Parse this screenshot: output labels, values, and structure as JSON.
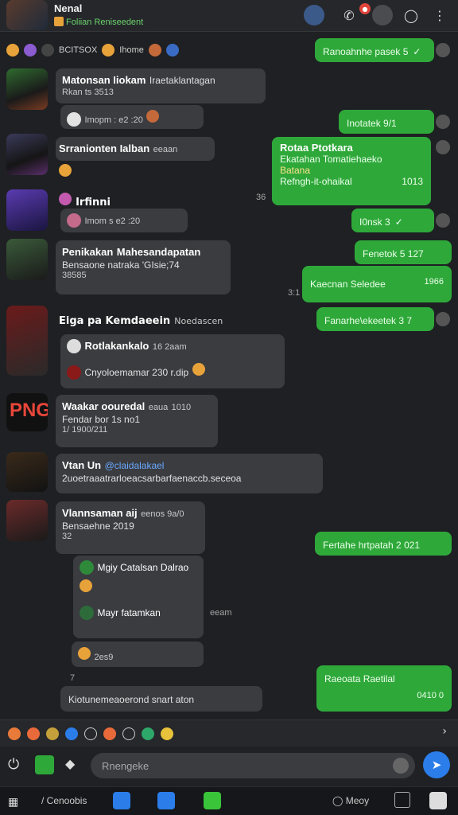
{
  "header": {
    "title": "Nenal",
    "subtitle": "Foliian Reniseedent"
  },
  "pinned": {
    "text1": "BCITSOX",
    "text2": "Ihome"
  },
  "messages": {
    "m1": {
      "name": "Matonsan Iiokam",
      "name_suffix": "Iraetaklantagan",
      "line": "Rkan ts 3513",
      "sub": "Imopm : e2 :20"
    },
    "m2": {
      "name": "Srranionten Ialban",
      "name_suffix": "eeaan"
    },
    "m3": {
      "name": "Irfinni",
      "sub": "Imom s e2 :20"
    },
    "m4": {
      "name": "Penikakan",
      "name_suffix": "Mahesandapatan",
      "line": "Bensaone natraka 'GIsie;74",
      "meta": "38585"
    },
    "m5": {
      "name": "Eiga pa Kemdaeein",
      "name_suffix": "Noedascen",
      "quote_name": "Rotlakankalo",
      "quote_time": "16 2aam",
      "line": "Cnyoloemamar 230 r.dip"
    },
    "m6": {
      "name": "Waakar oouredal",
      "name_suffix": "eaua",
      "time": "1010",
      "line": "Fendar bor 1s no1",
      "meta": "1/ 1900/211"
    },
    "m7": {
      "name": "Vtan Un",
      "link": "@claidalakael",
      "line": "2uoetraaatrarloeacsarbarfaenaccb.seceoa"
    },
    "m8": {
      "name": "Vlannsaman aij",
      "name_suffix": "eenos 9a/0",
      "line": "Bensaehne 2019",
      "meta": "32"
    },
    "m8a": {
      "name": "Mgiy Catalsan Dalrao"
    },
    "m8b": {
      "name": "Mayr fatamkan",
      "time": "eeam"
    },
    "m8c": {
      "text": "2es9"
    },
    "m9": {
      "line": "Kiotunemeaoerond snart aton"
    }
  },
  "outgoing": {
    "o1": {
      "text": "Ranoahnhe pasek 5"
    },
    "o2": {
      "text": "Inotatek 9/1"
    },
    "o3": {
      "title": "Rotaa Ptotkara",
      "line1": "Ekatahan Tomatiehaeko",
      "line2": "Batana",
      "line3": "Refngh-it-ohaikal",
      "time": "1013"
    },
    "o4": {
      "text": "I0nsk 3"
    },
    "o5": {
      "text": "Fenetok 5 127"
    },
    "o6": {
      "text": "Kaecnan Seledee",
      "time": "1966"
    },
    "o7": {
      "text": "Fanarhe\\ekeetek 3 7"
    },
    "o8": {
      "text": "Fertahe hrtpatah 2 021"
    },
    "o9": {
      "text": "Raeoata Raetilal",
      "time": "0410 0"
    }
  },
  "side_times": {
    "t1": "36",
    "t2": "3:1",
    "t3": "7"
  },
  "composer": {
    "placeholder": "Rnengeke"
  },
  "taskbar": {
    "item1": "Cenoobis",
    "item2": "Meoy"
  },
  "colors": {
    "background": "#1e2023",
    "incoming_bubble": "#3a3c40",
    "outgoing_bubble": "#2fa83a",
    "accent": "#2b7de9"
  }
}
